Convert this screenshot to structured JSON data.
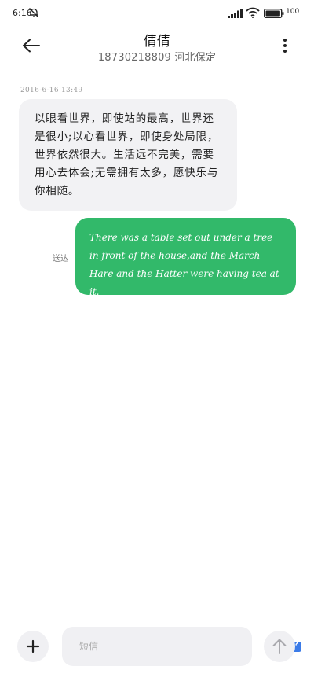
{
  "status_bar": {
    "time": "6:16",
    "battery": "100"
  },
  "header": {
    "contact_name": "倩倩",
    "contact_info": "18730218809 河北保定"
  },
  "conversation": {
    "timestamp": "2016-6-16 13:49",
    "incoming_message": "以眼看世界，即使站的最高，世界还是很小;以心看世界，即使身处局限，世界依然很大。生活远不完美，需要用心去体会;无需拥有太多，愿快乐与你相随。",
    "sent_label": "送达",
    "outgoing_message": "There was a table set out under a tree in front of the house,and the March Hare and the Hatter were having tea at it."
  },
  "composer": {
    "placeholder": "短信"
  },
  "icons": {
    "back": "arrow-left-icon",
    "more": "more-vertical-icon",
    "add": "plus-icon",
    "send": "arrow-up-icon",
    "sms": "sms-indicator-icon"
  },
  "colors": {
    "outgoing_bubble": "#32b96a",
    "incoming_bubble": "#f2f2f4",
    "sms_indicator": "#3b7be8"
  }
}
